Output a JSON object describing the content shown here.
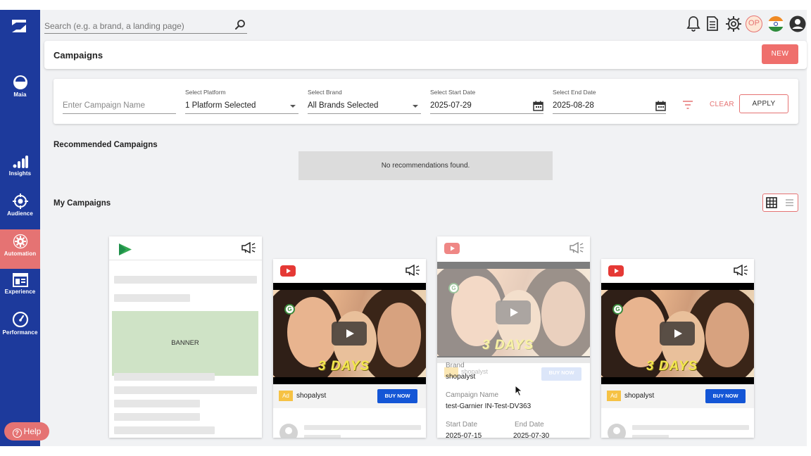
{
  "sidebar": {
    "items": [
      {
        "label": "Maia",
        "icon": "maia-icon"
      },
      {
        "label": "Insights",
        "icon": "bar-chart-icon"
      },
      {
        "label": "Audience",
        "icon": "target-icon"
      },
      {
        "label": "Automation",
        "icon": "gear-icon",
        "active": true
      },
      {
        "label": "Experience",
        "icon": "browser-window-icon"
      },
      {
        "label": "Performance",
        "icon": "speedometer-icon"
      }
    ],
    "help_label": "Help"
  },
  "topbar": {
    "search_placeholder": "Search (e.g. a brand, a landing page)",
    "profile_initials": "OP",
    "icons": [
      "bell-icon",
      "document-icon",
      "settings-icon",
      "profile-initials-icon",
      "india-flag-icon",
      "account-icon"
    ]
  },
  "header": {
    "title": "Campaigns",
    "new_label": "NEW"
  },
  "filters": {
    "campaign_name_placeholder": "Enter Campaign Name",
    "platform": {
      "label": "Select Platform",
      "value": "1 Platform Selected"
    },
    "brand": {
      "label": "Select Brand",
      "value": "All Brands Selected"
    },
    "start_date": {
      "label": "Select Start Date",
      "value": "2025-07-29"
    },
    "end_date": {
      "label": "Select End Date",
      "value": "2025-08-28"
    },
    "clear_label": "CLEAR",
    "apply_label": "APPLY"
  },
  "recommended": {
    "title": "Recommended Campaigns",
    "empty_text": "No recommendations found."
  },
  "my_campaigns": {
    "title": "My Campaigns",
    "cards": [
      {
        "platform": "google-play-icon",
        "banner_text": "BANNER"
      },
      {
        "platform": "youtube-icon",
        "video_text": "3 DAYS",
        "advertiser": "shopalyst",
        "ad_tag": "Ad",
        "cta": "BUY NOW"
      },
      {
        "platform": "youtube-icon",
        "video_text": "3 DAYS",
        "overlay_cta": "BUY NOW",
        "overlay_advertiser": "shopalyst",
        "brand_label": "Brand",
        "brand_value": "shopalyst",
        "campaign_name_label": "Campaign Name",
        "campaign_name_value": "test-Garnier IN-Test-DV363",
        "start_date_label": "Start Date",
        "start_date_value": "2025-07-15",
        "end_date_label": "End Date",
        "end_date_value": "2025-07-30"
      },
      {
        "platform": "youtube-icon",
        "video_text": "3 DAYS",
        "advertiser": "shopalyst",
        "ad_tag": "Ad",
        "cta": "BUY NOW"
      }
    ]
  },
  "colors": {
    "sidebar": "#1d3a9c",
    "accent": "#e57373",
    "buy_now": "#1456d6",
    "youtube": "#e53935"
  }
}
